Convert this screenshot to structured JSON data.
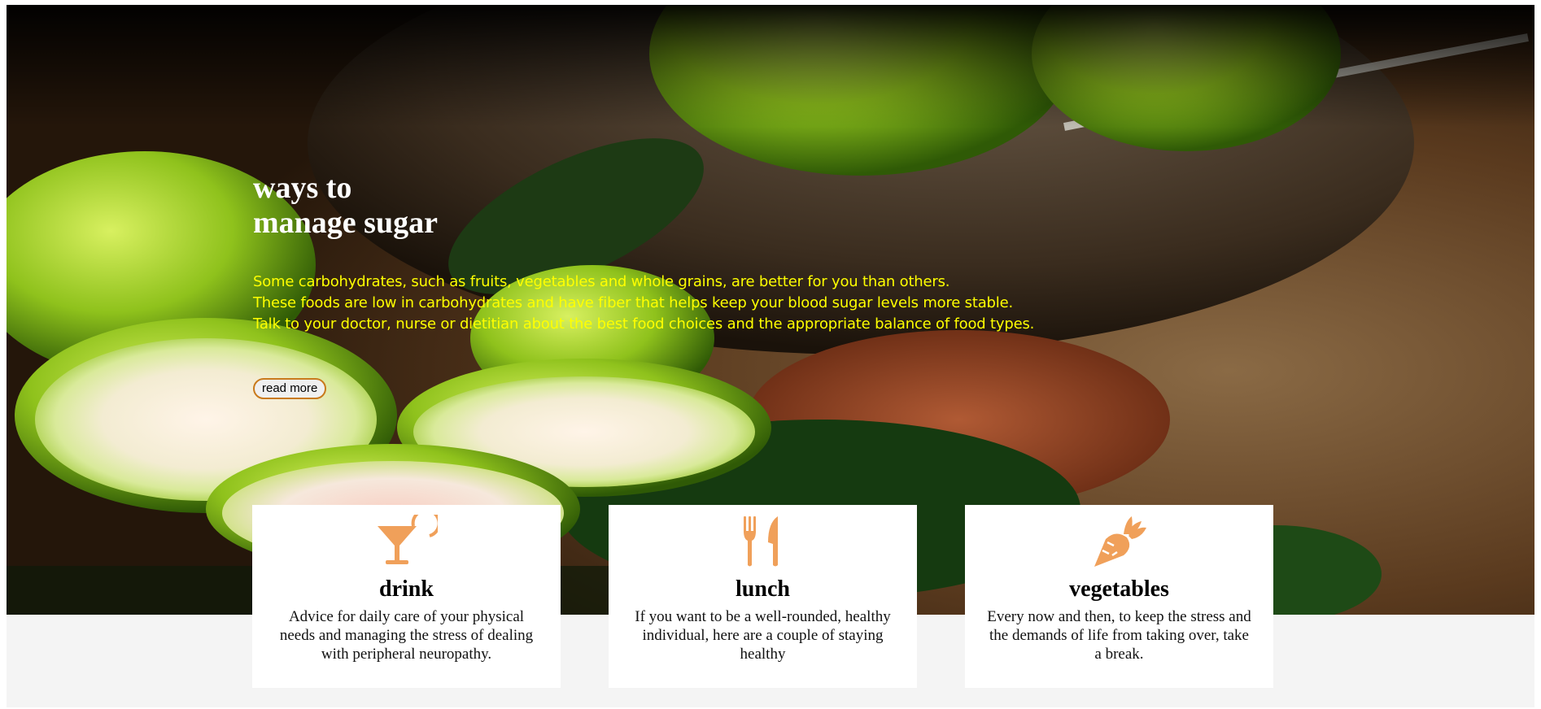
{
  "hero": {
    "title_line1": "ways to",
    "title_line2": "manage sugar",
    "text_lines": [
      "Some carbohydrates, such as fruits, vegetables and whole grains, are better for you than others.",
      "These foods are low in carbohydrates and have fiber that helps keep your blood sugar levels more stable.",
      "Talk to your doctor, nurse or dietitian about the best food choices and the appropriate balance of food types."
    ],
    "button_label": "read more"
  },
  "colors": {
    "title": "#ffffff",
    "text": "#ffff00",
    "accent": "#f0a05a",
    "band": "#f4f4f4",
    "button_border": "#c97a1c"
  },
  "cards": [
    {
      "icon": "cocktail-icon",
      "title": "drink",
      "text": "Advice for daily care of your physical needs and managing the stress of dealing with peripheral neuropathy."
    },
    {
      "icon": "fork-knife-icon",
      "title": "lunch",
      "text": "If you want to be a well-rounded, healthy individual, here are a couple of staying healthy"
    },
    {
      "icon": "carrot-icon",
      "title": "vegetables",
      "text": "Every now and then, to keep the stress and the demands of life from taking over, take a break."
    }
  ]
}
